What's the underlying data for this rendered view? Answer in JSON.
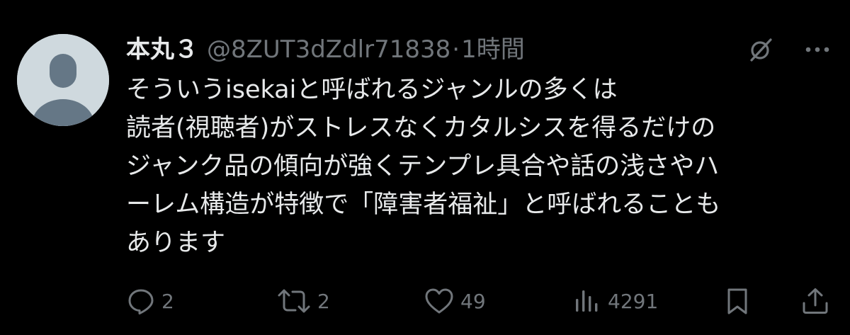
{
  "tweet": {
    "display_name": "本丸３",
    "handle": "@8ZUT3dZdlr71838",
    "separator": "·",
    "time": "1時間",
    "body_lines": [
      "そういうisekaiと呼ばれるジャンルの多くは",
      "読者(視聴者)がストレスなくカタルシスを得るだけの",
      "ジャンク品の傾向が強くテンプレ具合や話の浅さやハ",
      "ーレム構造が特徴で「障害者福祉」と呼ばれることも",
      "あります"
    ],
    "stats": {
      "replies": "2",
      "reposts": "2",
      "likes": "49",
      "views": "4291"
    }
  },
  "icons": {
    "header": [
      "grok-icon",
      "more-icon"
    ],
    "actions": [
      "reply-icon",
      "repost-icon",
      "like-icon",
      "views-icon",
      "bookmark-icon",
      "share-icon"
    ]
  },
  "colors": {
    "background": "#000000",
    "primary_text": "#e7e9ea",
    "secondary_text": "#71767b",
    "avatar_bg": "#cfd9de",
    "avatar_fg": "#657786"
  }
}
